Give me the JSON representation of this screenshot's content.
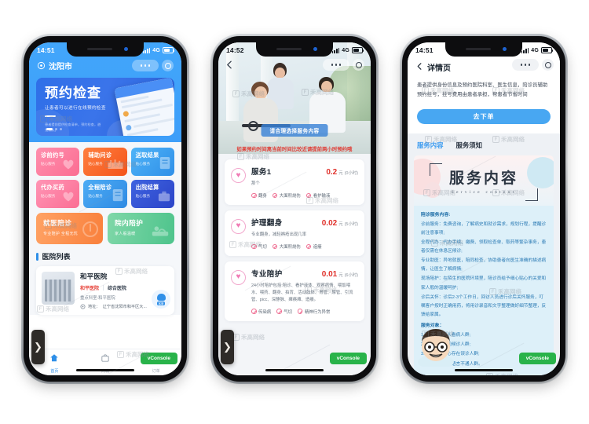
{
  "meta": {
    "background": "#ffffff",
    "accent_blue": "#2f8fe8",
    "price_red": "#e0302a",
    "vconsole_green": "#29b34a"
  },
  "phone1": {
    "status": {
      "time": "14:51",
      "network": "4G"
    },
    "header": {
      "city": "沈阳市",
      "location_icon": "location-pin-icon"
    },
    "banner": {
      "title": "预约检查",
      "subtitle": "让患者可以进行在线预约检查",
      "note": "患者提前提供检查清单，预约检查，避免排队。"
    },
    "grid": [
      {
        "title": "诊前约号",
        "sub": "贴心服务",
        "color": "#fb6d92",
        "icon": "heart-hands-icon"
      },
      {
        "title": "辅助问诊",
        "sub": "贴心服务",
        "color": "#f4541a",
        "icon": "clinic-icon"
      },
      {
        "title": "送取结果",
        "sub": "贴心服务",
        "color": "#2f8fe8",
        "icon": "report-icon"
      },
      {
        "title": "代办买药",
        "sub": "贴心服务",
        "color": "#fb6e94",
        "icon": "heart-hands-icon"
      },
      {
        "title": "全程陪诊",
        "sub": "贴心服务",
        "color": "#2e8ae3",
        "icon": "report-icon"
      },
      {
        "title": "出院结算",
        "sub": "贴心服务",
        "color": "#2b44c8",
        "icon": "briefcase-icon"
      }
    ],
    "wide_cards": [
      {
        "title": "就医陪诊",
        "sub": "专业陪护 全程无忧",
        "color": "#f9803c",
        "icon": "stethoscope-icon"
      },
      {
        "title": "院内陪护",
        "sub": "家人般温暖",
        "color": "#4ec48c",
        "icon": "bed-care-icon"
      }
    ],
    "section_title": "医院列表",
    "hospital": {
      "name": "和平医院",
      "tag_red": "和平医院",
      "tag_grey": "综合医院",
      "dept": "重点科室:和平医院",
      "address_label": "地址：",
      "address": "辽宁省沈阳市和平区大...",
      "address_icon": "location-pin-icon",
      "service_badge": "客服"
    },
    "tabs": [
      {
        "label": "首页",
        "icon": "home-icon",
        "active": true
      },
      {
        "label": "商城",
        "icon": "shop-bag-icon",
        "active": false
      },
      {
        "label": "订单",
        "icon": "order-list-icon",
        "active": false
      }
    ],
    "vconsole": "vConsole"
  },
  "phone2": {
    "status": {
      "time": "14:52",
      "network": "4G"
    },
    "back_icon": "back-arrow-icon",
    "hero_tag": "请合理选择服务内容",
    "warning": "如果预约时间离当前时间比较近请提前两小时预约哦",
    "services": [
      {
        "name": "服务1",
        "price": "0.2",
        "unit": "元",
        "duration": "(0小时)",
        "desc": "那个",
        "icon": "heart-circle-icon",
        "tags": [
          "翻身",
          "大面积烧伤",
          "看护输液"
        ]
      },
      {
        "name": "护理翻身",
        "price": "0.02",
        "unit": "元",
        "duration": "(5小时)",
        "desc": "专业翻身，减轻褥疮出现几率",
        "icon": "heart-circle-icon",
        "tags": [
          "气切",
          "大面积烧伤",
          "造瘘"
        ]
      },
      {
        "name": "专业陪护",
        "price": "0.01",
        "unit": "元",
        "duration": "(6小时)",
        "desc": "24小时陪护包括:陪诊、看护液体、观察病情、喂饭喂水、喂药、翻身、拍背、活动肢体、胃管、尿管、引流管、picc、深静脉、瘫痪瘫、造瘘。",
        "icon": "heart-circle-icon",
        "tags": [
          "传染病",
          "气切",
          "精神行为异常"
        ]
      }
    ],
    "vconsole": "vConsole"
  },
  "phone3": {
    "status": {
      "time": "14:51",
      "network": "4G"
    },
    "back_icon": "back-arrow-icon",
    "title": "详情页",
    "description": "患者提供身份信息及预约医院科室、医生信息，陪诊员辅助预约挂号，挂号费用由患者承担，帮患者节省时间",
    "order_button": "去下单",
    "tabs": [
      {
        "label": "服务内容",
        "active": true
      },
      {
        "label": "服务须知",
        "active": false
      }
    ],
    "poster": {
      "title_zh": "服务内容",
      "title_en": "Service content",
      "heading": "陪诊服务内容:",
      "paragraphs": [
        "诊前服务：免费咨询，了解病史和就诊需求，规划行程，提醒诊前注意事项;",
        "全程代办：代办手续、缴费、领取检查单、取药等繁杂事务，患者仅需在休息区候诊;",
        "专业助医：异地就医，陪同检查，协助患者向医生准确的描述病情，让医生了解病情;",
        "现场陪护：在陌生的医院环境里，陪诊员给予细心贴心的关爱和家人般的温暖呵护;",
        "诊后关怀：诊后2-3个工作日，回访人员进行诊后关怀服务，叮嘱客户按时正确用药，将用诊录音和文字整理做好细节整理，反馈给家属。"
      ],
      "target_heading": "服务对象：",
      "targets": [
        "1.没时间陪高人看病人群;",
        "2.不想浪费时间候诊人群;",
        "3.病情不明担心存在误诊人群;",
        "4.流程繁杂外来语言不通人群。"
      ]
    },
    "doctor_avatar": "doctor-avatar-icon",
    "vconsole": "vConsole"
  },
  "nav": {
    "prev_icon": "chevron-right-icon",
    "label": "❯"
  },
  "watermark": {
    "text": "禾高网络"
  }
}
